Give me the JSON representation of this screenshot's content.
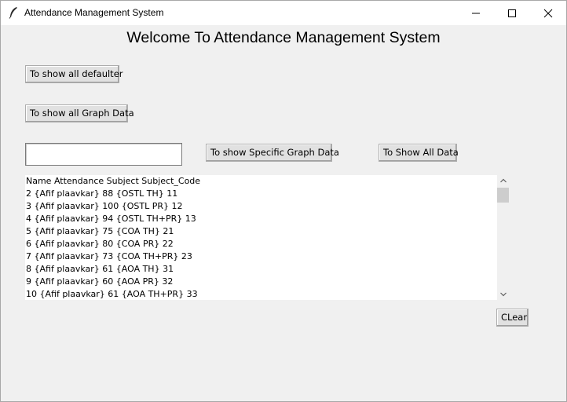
{
  "window": {
    "title": "Attendance Management System"
  },
  "heading": "Welcome To Attendance Management System",
  "buttons": {
    "defaulter": "To show all defaulter",
    "graph_data": "To show all Graph Data",
    "specific_graph": "To show Specific Graph Data",
    "all_data": "To Show All Data",
    "clear": "CLear"
  },
  "search": {
    "value": "",
    "placeholder": ""
  },
  "list": {
    "lines": [
      "Name Attendance Subject Subject_Code",
      "2 {Afif plaavkar} 88 {OSTL TH} 11",
      "3 {Afif plaavkar} 100 {OSTL PR} 12",
      "4 {Afif plaavkar} 94 {OSTL TH+PR} 13",
      "5 {Afif plaavkar} 75 {COA TH} 21",
      "6 {Afif plaavkar} 80 {COA PR} 22",
      "7 {Afif plaavkar} 73 {COA TH+PR} 23",
      "8 {Afif plaavkar} 61 {AOA TH} 31",
      "9 {Afif plaavkar} 60 {AOA PR} 32",
      "10 {Afif plaavkar} 61 {AOA TH+PR} 33"
    ]
  },
  "icons": {
    "app": "feather-icon",
    "minimize": "minimize-icon",
    "maximize": "maximize-icon",
    "close": "close-icon",
    "scroll_up": "chevron-up-icon",
    "scroll_down": "chevron-down-icon"
  }
}
